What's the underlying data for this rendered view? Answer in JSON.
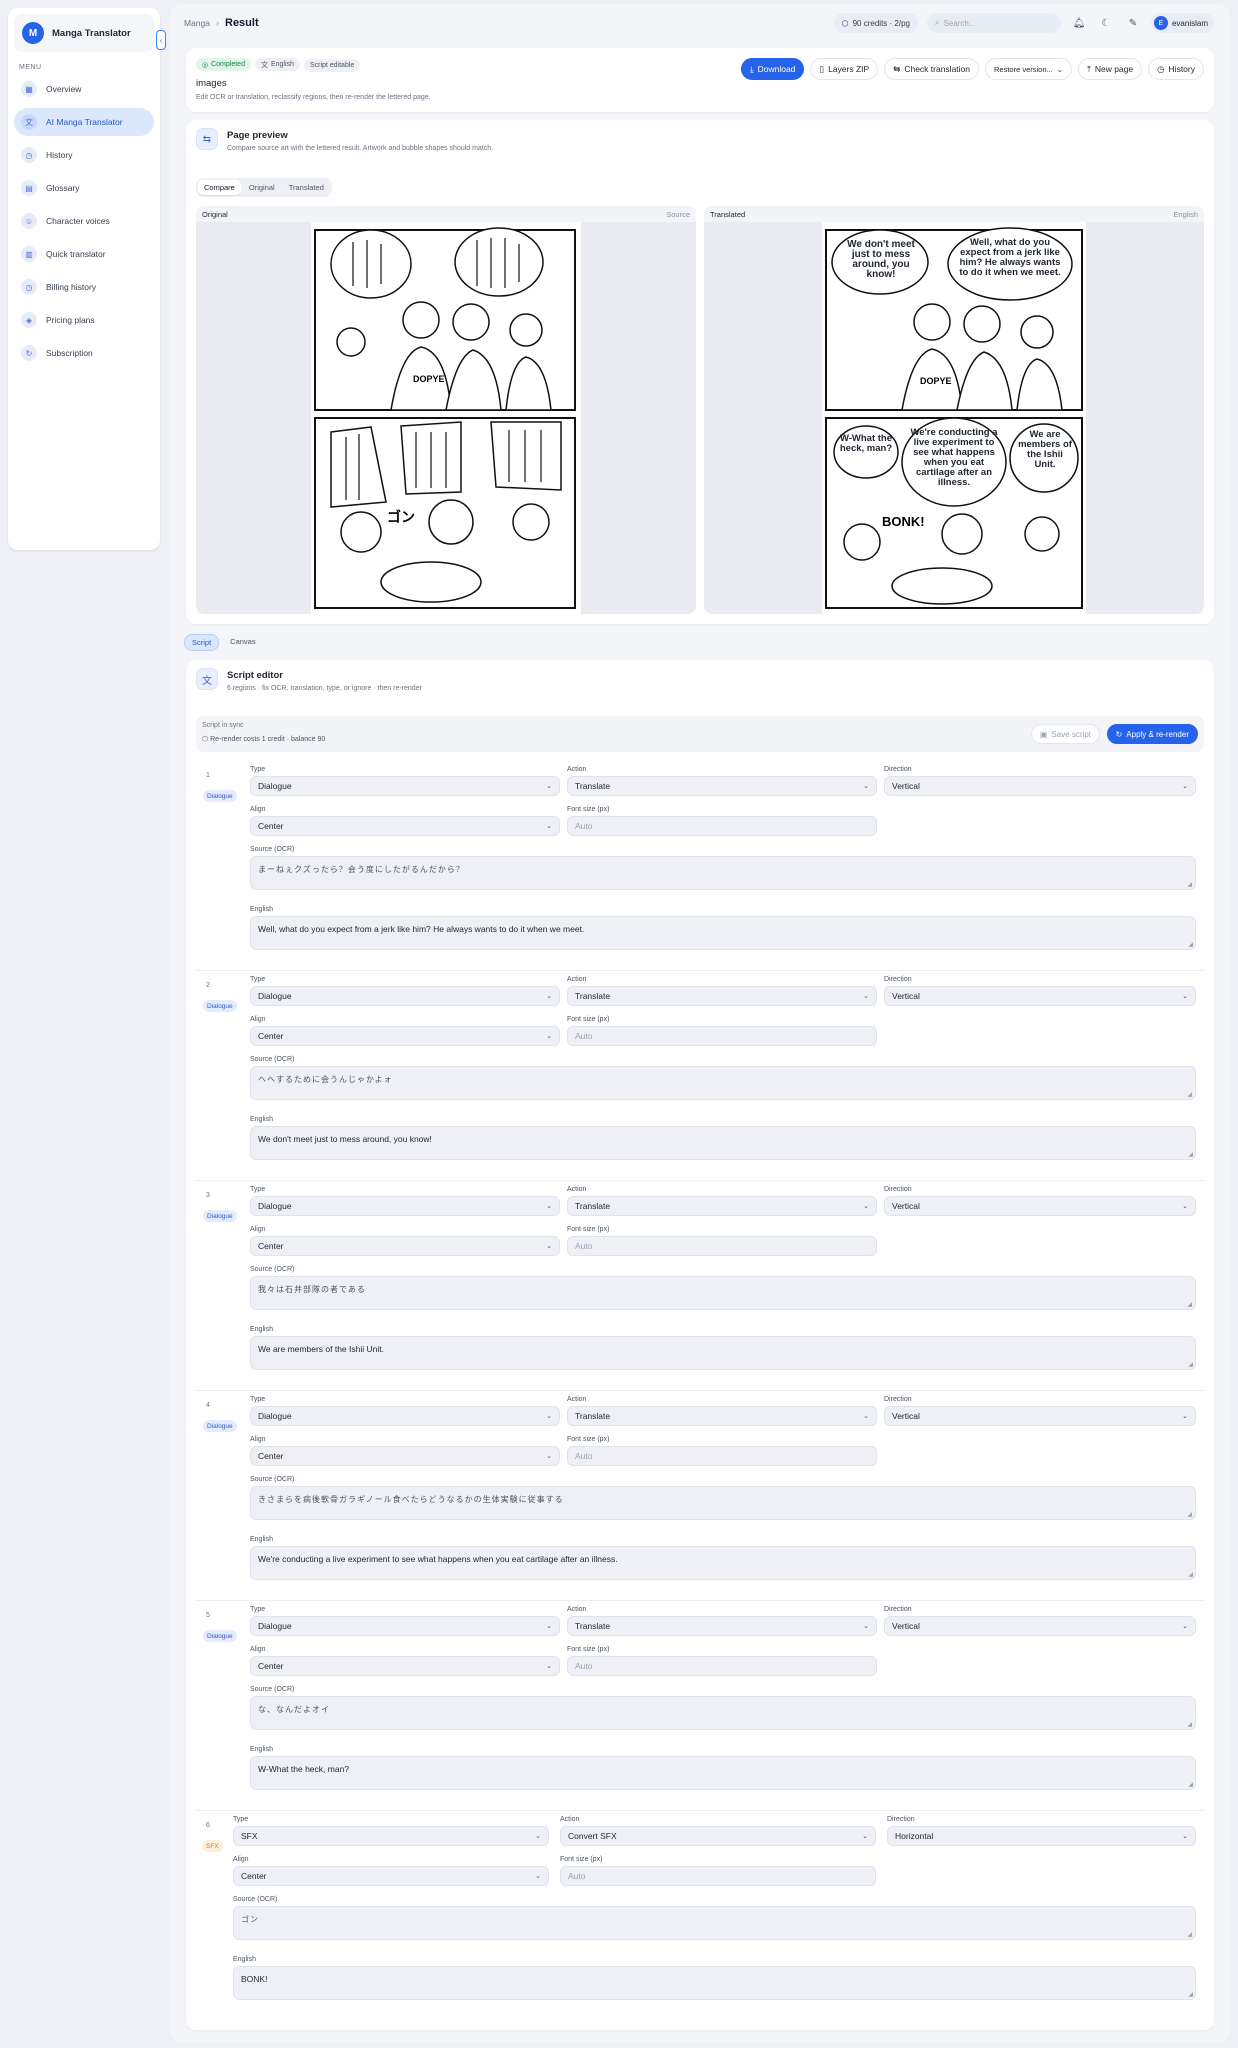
{
  "sidebar": {
    "logo_letter": "M",
    "title": "Manga Translator",
    "menu_label": "MENU",
    "items": [
      {
        "label": "Overview",
        "icon": "grid-icon"
      },
      {
        "label": "AI Manga Translator",
        "icon": "translate-icon"
      },
      {
        "label": "History",
        "icon": "clock-icon"
      },
      {
        "label": "Glossary",
        "icon": "book-icon"
      },
      {
        "label": "Character voices",
        "icon": "users-icon"
      },
      {
        "label": "Quick translator",
        "icon": "document-icon"
      },
      {
        "label": "Billing history",
        "icon": "receipt-icon"
      },
      {
        "label": "Pricing plans",
        "icon": "box-icon"
      },
      {
        "label": "Subscription",
        "icon": "refresh-icon"
      }
    ]
  },
  "topbar": {
    "crumb": "Manga",
    "current": "Result",
    "credits": "90 credits · 2/pg",
    "search_placeholder": "Search...",
    "avatar": "E",
    "username": "evanislam"
  },
  "result": {
    "status": "Completed",
    "language": "English",
    "script_status": "Script editable",
    "title": "images",
    "desc": "Edit OCR or translation, reclassify regions, then re-render the lettered page.",
    "buttons": {
      "download": "Download",
      "layers": "Layers ZIP",
      "check": "Check translation",
      "restore": "Restore version...",
      "new_page": "New page",
      "history": "History"
    }
  },
  "preview": {
    "title": "Page preview",
    "sub": "Compare source art with the lettered result. Artwork and bubble shapes should match.",
    "tabs": [
      "Compare",
      "Original",
      "Translated"
    ],
    "original_label": "Original",
    "original_right": "Source",
    "translated_label": "Translated",
    "translated_right": "English",
    "bubbles_en": [
      "We don't meet just to mess around, you know!",
      "Well, what do you expect from a jerk like him? He always wants to do it when we meet.",
      "W-What the heck, man?",
      "We're conducting a live experiment to see what happens when you eat cartilage after an illness.",
      "We are members of the Ishii Unit."
    ],
    "sfx_en": "BONK!",
    "shirt": "DOPYE"
  },
  "view_tabs": [
    "Script",
    "Canvas"
  ],
  "editor": {
    "title": "Script editor",
    "sub": "6 regions · fix OCR, translation, type, or ignore · then re-render",
    "sync": "Script in sync",
    "cost": "Re-render costs 1 credit · balance 90",
    "save": "Save script",
    "apply": "Apply & re-render",
    "labels": {
      "type": "Type",
      "action": "Action",
      "direction": "Direction",
      "align": "Align",
      "font_size": "Font size (px)",
      "source": "Source (OCR)",
      "english": "English"
    },
    "regions": [
      {
        "num": "1",
        "tag": "Dialogue",
        "type": "Dialogue",
        "action": "Translate",
        "direction": "Vertical",
        "align": "Center",
        "font_ph": "Auto",
        "source": "まーねぇクズったら？会う度にしたがるんだから？",
        "english": "Well, what do you expect from a jerk like him? He always wants to do it when we meet."
      },
      {
        "num": "2",
        "tag": "Dialogue",
        "type": "Dialogue",
        "action": "Translate",
        "direction": "Vertical",
        "align": "Center",
        "font_ph": "Auto",
        "source": "ヘヘするために会うんじゃかよォ",
        "english": "We don't meet just to mess around, you know!"
      },
      {
        "num": "3",
        "tag": "Dialogue",
        "type": "Dialogue",
        "action": "Translate",
        "direction": "Vertical",
        "align": "Center",
        "font_ph": "Auto",
        "source": "我々は石井部隊の者である",
        "english": "We are members of the Ishii Unit."
      },
      {
        "num": "4",
        "tag": "Dialogue",
        "type": "Dialogue",
        "action": "Translate",
        "direction": "Vertical",
        "align": "Center",
        "font_ph": "Auto",
        "source": "きさまらを病後軟骨ガラギノール食べたらどうなるかの生体実験に従事する",
        "english": "We're conducting a live experiment to see what happens when you eat cartilage after an illness."
      },
      {
        "num": "5",
        "tag": "Dialogue",
        "type": "Dialogue",
        "action": "Translate",
        "direction": "Vertical",
        "align": "Center",
        "font_ph": "Auto",
        "source": "な、なんだよオイ",
        "english": "W-What the heck, man?"
      },
      {
        "num": "6",
        "tag": "SFX",
        "type": "SFX",
        "action": "Convert SFX",
        "direction": "Horizontal",
        "align": "Center",
        "font_ph": "Auto",
        "source": "ゴン",
        "english": "BONK!"
      }
    ]
  },
  "colors": {
    "accent": "#2563eb",
    "sfx": "#d77b2b",
    "success": "#15803d"
  }
}
